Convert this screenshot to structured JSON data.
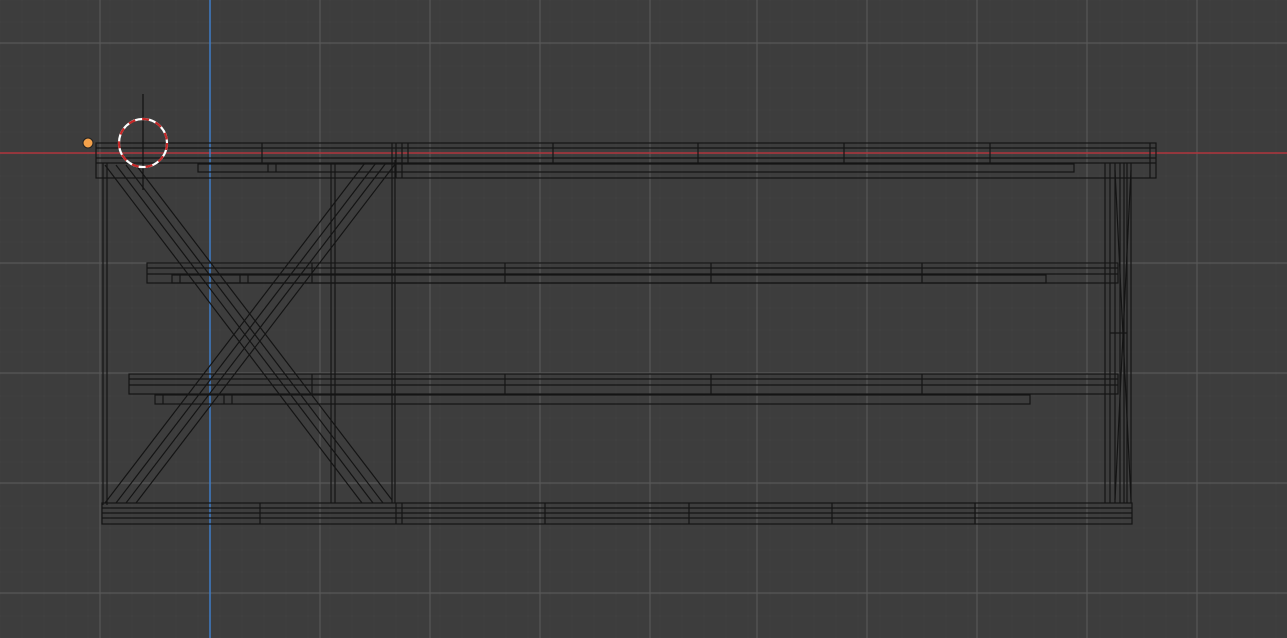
{
  "viewport": {
    "editor": "3D Viewport",
    "view": "wireframe",
    "axes": {
      "x_axis_color": "#b0353d",
      "z_axis_color": "#3f7dc6"
    },
    "colors": {
      "background": "#3d3d3d",
      "grid_minor": "#434343",
      "grid_major": "#575757",
      "wire": "#141414",
      "origin": "#f4a14a"
    }
  },
  "overlay": {
    "origin_icon": "origin-dot-icon",
    "cursor_icon": "3d-cursor-icon"
  },
  "scene": {
    "object": "table-frame-mesh"
  }
}
